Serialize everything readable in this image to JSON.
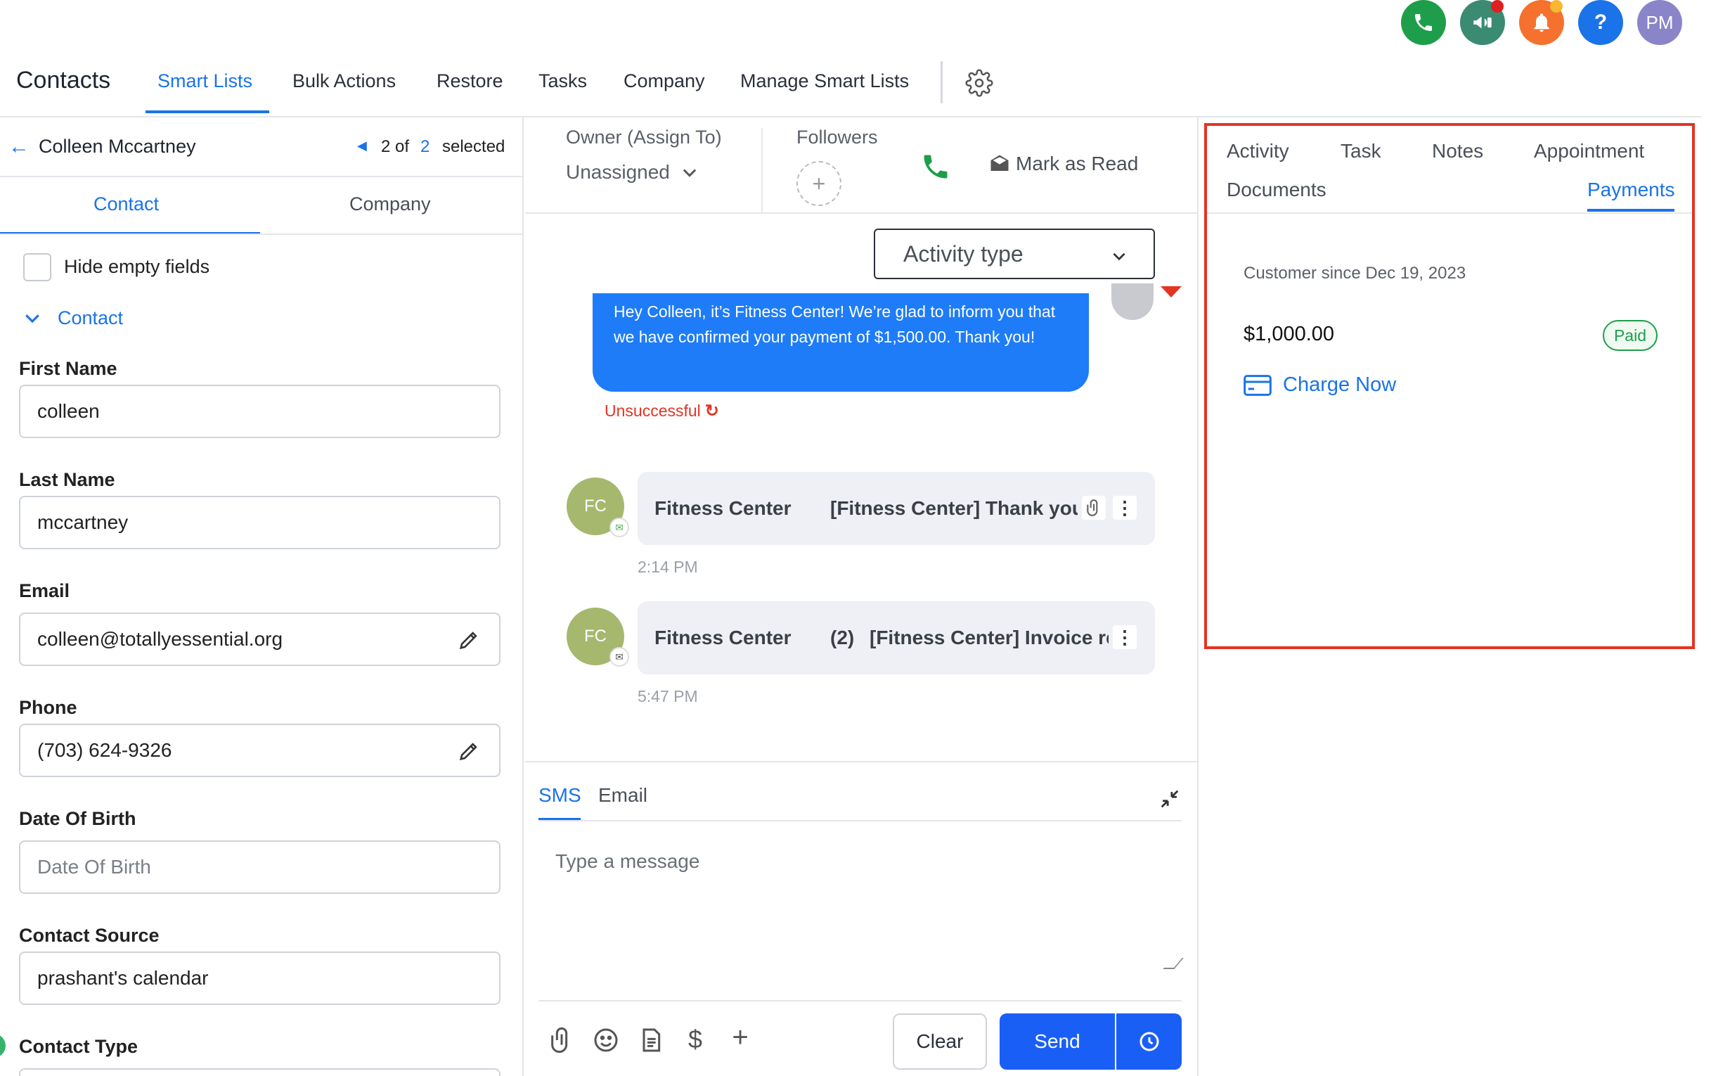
{
  "top_bar": {
    "avatar_initials": "PM",
    "icons": [
      {
        "name": "phone-icon",
        "color": "#1e9e4a"
      },
      {
        "name": "megaphone-icon",
        "color": "#3b8a72"
      },
      {
        "name": "bell-icon",
        "color": "#f5712d"
      },
      {
        "name": "help-icon",
        "color": "#1a73e8"
      },
      {
        "name": "avatar",
        "color": "#8a85c8"
      }
    ],
    "help_glyph": "?"
  },
  "nav": {
    "title": "Contacts",
    "items": [
      "Smart Lists",
      "Bulk Actions",
      "Restore",
      "Tasks",
      "Company",
      "Manage Smart Lists"
    ],
    "active": "Smart Lists"
  },
  "contact_header": {
    "name": "Colleen Mccartney",
    "pager_prefix": "2 of",
    "pager_total": "2",
    "selected_label": "selected"
  },
  "left_tabs": [
    "Contact",
    "Company"
  ],
  "hide_empty": "Hide empty fields",
  "section_title": "Contact",
  "fields": {
    "first_name": {
      "label": "First Name",
      "value": "colleen"
    },
    "last_name": {
      "label": "Last Name",
      "value": "mccartney"
    },
    "email": {
      "label": "Email",
      "value": "colleen@totallyessential.org"
    },
    "phone": {
      "label": "Phone",
      "value": "(703) 624-9326"
    },
    "dob": {
      "label": "Date Of Birth",
      "placeholder": "Date Of Birth"
    },
    "source": {
      "label": "Contact Source",
      "value": "prashant's calendar"
    },
    "type": {
      "label": "Contact Type"
    }
  },
  "conversation_header": {
    "owner_label": "Owner (Assign To)",
    "owner_value": "Unassigned",
    "followers_label": "Followers",
    "mark_read": "Mark as Read"
  },
  "activity_filter": "Activity type",
  "messages": {
    "sms_bubble": "Hey Colleen, it’s Fitness Center! We’re glad to inform you that we have confirmed your payment of $1,500.00. Thank you!",
    "sms_status": "Unsuccessful",
    "email1": {
      "avatar": "FC",
      "sender": "Fitness Center",
      "subject": "[Fitness Center] Thank you",
      "time": "2:14 PM"
    },
    "email2": {
      "avatar": "FC",
      "sender": "Fitness Center",
      "count": "(2)",
      "subject": "[Fitness Center] Invoice re",
      "time": "5:47 PM"
    }
  },
  "composer": {
    "tabs": [
      "SMS",
      "Email"
    ],
    "active_tab": "SMS",
    "placeholder": "Type a message",
    "clear": "Clear",
    "send": "Send"
  },
  "right_panel": {
    "tabs_row1": [
      "Activity",
      "Task",
      "Notes",
      "Appointment"
    ],
    "tabs_row2": [
      "Documents",
      "Payments"
    ],
    "active_tab": "Payments",
    "customer_since": "Customer since Dec 19, 2023",
    "amount": "$1,000.00",
    "status": "Paid",
    "charge_now": "Charge Now"
  },
  "colors": {
    "accent": "#1a73e8",
    "error": "#e53322",
    "paid_green": "#1e9e4a"
  }
}
